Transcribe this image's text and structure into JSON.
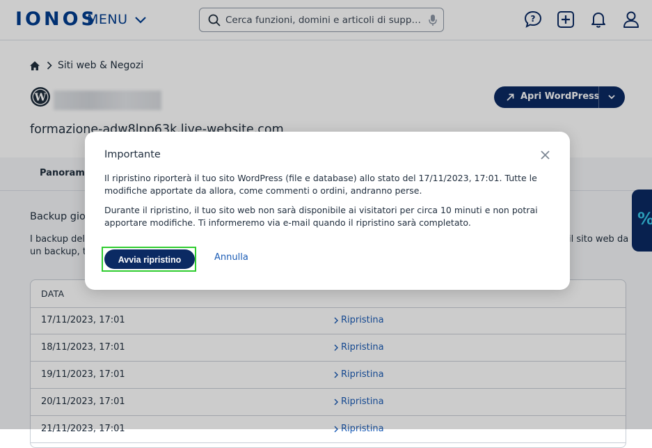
{
  "header": {
    "logo": "IONOS",
    "menu_label": "MENU",
    "search_placeholder": "Cerca funzioni, domini e articoli di supporto"
  },
  "breadcrumb": {
    "item": "Siti web & Negozi"
  },
  "site": {
    "domain": "formazione-adw8lpp63k.live-website.com",
    "open_button": "Apri WordPress"
  },
  "tabs": {
    "first": "Panoramica"
  },
  "section": {
    "title": "Backup gior",
    "desc_line1": "I backup del t",
    "desc_line2": "un backup, tu",
    "desc_right": "il sito web da"
  },
  "promo": {
    "symbol": "%"
  },
  "table": {
    "header": "DATA",
    "action_label": "Ripristina",
    "rows": [
      "17/11/2023, 17:01",
      "18/11/2023, 17:01",
      "19/11/2023, 17:01",
      "20/11/2023, 17:01",
      "21/11/2023, 17:01"
    ]
  },
  "modal": {
    "title": "Importante",
    "paragraph1": "Il ripristino riporterà il tuo sito WordPress (file e database) allo stato del 17/11/2023, 17:01. Tutte le modifiche apportate da allora, come commenti o ordini, andranno perse.",
    "paragraph2": "Durante il ripristino, il tuo sito web non sarà disponibile ai visitatori per circa 10 minuti e non potrai apportare modifiche. Ti informeremo via e-mail quando il ripristino sarà completato.",
    "confirm_label": "Avvia ripristino",
    "cancel_label": "Annulla"
  },
  "colors": {
    "brand": "#003d8f",
    "primary_button": "#0b2a63",
    "link": "#1a5bb5",
    "highlight": "#2ecc2e"
  }
}
